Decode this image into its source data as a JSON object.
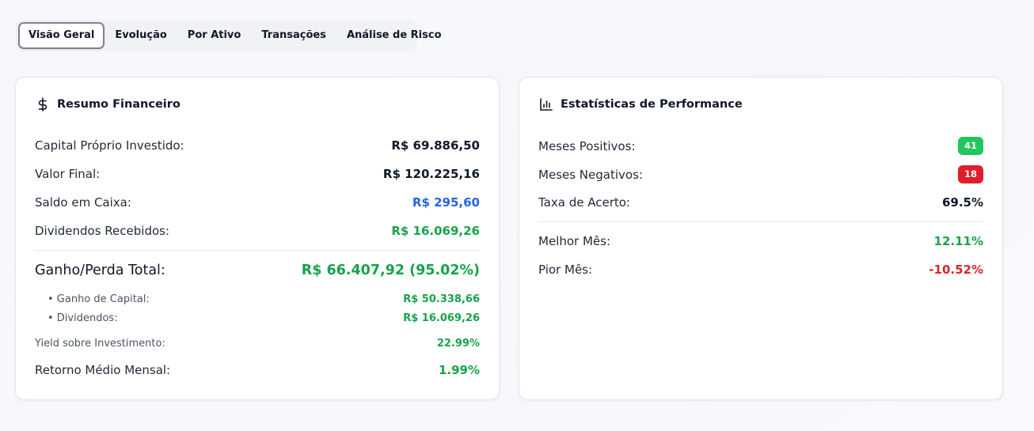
{
  "tabs": [
    {
      "label": "Visão Geral",
      "active": true
    },
    {
      "label": "Evolução"
    },
    {
      "label": "Por Ativo"
    },
    {
      "label": "Transações"
    },
    {
      "label": "Análise de Risco"
    }
  ],
  "resumo": {
    "title": "Resumo Financeiro",
    "icon": "dollar-icon",
    "capital_label": "Capital Próprio Investido:",
    "capital_value": "R$ 69.886,50",
    "valor_final_label": "Valor Final:",
    "valor_final_value": "R$ 120.225,16",
    "saldo_label": "Saldo em Caixa:",
    "saldo_value": "R$ 295,60",
    "dividendos_label": "Dividendos Recebidos:",
    "dividendos_value": "R$ 16.069,26",
    "ganho_total_label": "Ganho/Perda Total:",
    "ganho_total_value": "R$ 66.407,92 (95.02%)",
    "ganho_capital_label": "• Ganho de Capital:",
    "ganho_capital_value": "R$ 50.338,66",
    "sub_dividendos_label": "• Dividendos:",
    "sub_dividendos_value": "R$ 16.069,26",
    "yield_label": "Yield sobre Investimento:",
    "yield_value": "22.99%",
    "retorno_label": "Retorno Médio Mensal:",
    "retorno_value": "1.99%"
  },
  "stats": {
    "title": "Estatísticas de Performance",
    "icon": "bar-chart-icon",
    "positivos_label": "Meses Positivos:",
    "positivos_value": "41",
    "negativos_label": "Meses Negativos:",
    "negativos_value": "18",
    "taxa_label": "Taxa de Acerto:",
    "taxa_value": "69.5%",
    "melhor_label": "Melhor Mês:",
    "melhor_value": "12.11%",
    "pior_label": "Pior Mês:",
    "pior_value": "-10.52%"
  },
  "colors": {
    "green": "#16a34a",
    "blue": "#2563eb",
    "red": "#dc2626",
    "badge_green": "#22c55e",
    "badge_red": "#e11d2c"
  }
}
